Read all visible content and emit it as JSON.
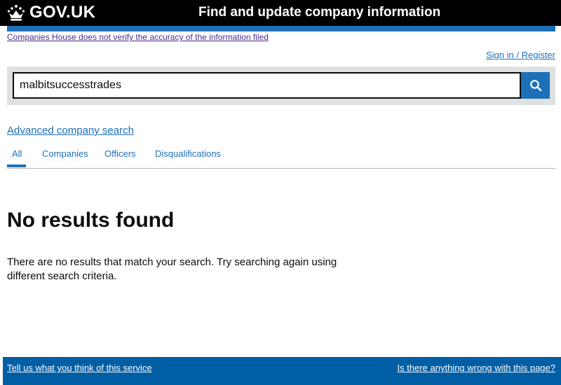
{
  "header": {
    "logo_text": "GOV.UK",
    "service_name": "Find and update company information"
  },
  "notice": {
    "disclaimer": "Companies House does not verify the accuracy of the information filed"
  },
  "account": {
    "signin_label": "Sign in / Register"
  },
  "search": {
    "value": "malbitsuccesstrades",
    "button_icon": "search-icon"
  },
  "advanced_search_label": "Advanced company search",
  "tabs": [
    {
      "label": "All",
      "active": true
    },
    {
      "label": "Companies",
      "active": false
    },
    {
      "label": "Officers",
      "active": false
    },
    {
      "label": "Disqualifications",
      "active": false
    }
  ],
  "results": {
    "heading": "No results found",
    "message": "There are no results that match your search. Try searching again using different search criteria."
  },
  "footer": {
    "feedback_label": "Tell us what you think of this service",
    "report_label": "Is there anything wrong with this page?"
  },
  "colors": {
    "header_bg": "#000000",
    "brand_blue": "#1d70b8",
    "footer_bg": "#005ea5"
  }
}
